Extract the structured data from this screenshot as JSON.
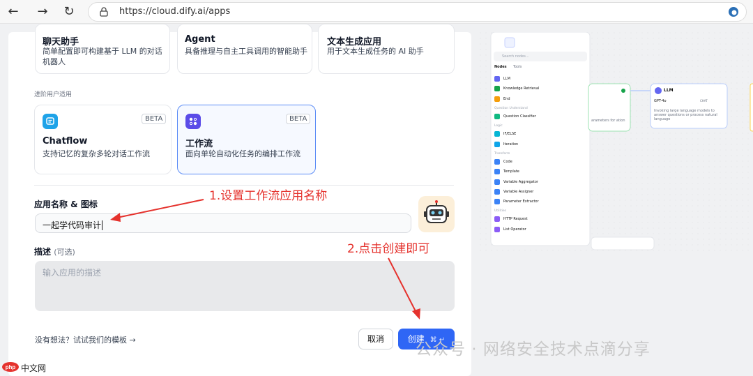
{
  "browser": {
    "url": "https://cloud.dify.ai/apps"
  },
  "app_types": {
    "basic": [
      {
        "title": "聊天助手",
        "desc": "简单配置即可构建基于 LLM 的对话机器人"
      },
      {
        "title": "Agent",
        "desc": "具备推理与自主工具调用的智能助手"
      },
      {
        "title": "文本生成应用",
        "desc": "用于文本生成任务的 AI 助手"
      }
    ],
    "advanced_label": "进阶用户适用",
    "advanced": [
      {
        "title": "Chatflow",
        "desc": "支持记忆的复杂多轮对话工作流",
        "badge": "BETA"
      },
      {
        "title": "工作流",
        "desc": "面向单轮自动化任务的编排工作流",
        "badge": "BETA"
      }
    ]
  },
  "form": {
    "name_label": "应用名称 & 图标",
    "name_value": "一起学代码审计",
    "desc_label": "描述",
    "desc_optional": "(可选)",
    "desc_placeholder": "输入应用的描述"
  },
  "footer": {
    "template_link": "没有想法？试试我们的模板",
    "template_arrow": "→",
    "cancel_label": "取消",
    "create_label": "创建",
    "create_shortcut": "⌘ ↵"
  },
  "annotations": {
    "step1": "1.设置工作流应用名称",
    "step2": "2.点击创建即可"
  },
  "preview": {
    "search_placeholder": "Search nodes...",
    "tabs": [
      "Nodes",
      "Tools"
    ],
    "groups": [
      {
        "title": "",
        "items": [
          "LLM",
          "Knowledge Retrieval",
          "End"
        ]
      },
      {
        "title": "Question Understand",
        "items": [
          "Question Classifier"
        ]
      },
      {
        "title": "Logic",
        "items": [
          "IF/ELSE",
          "Iteration"
        ]
      },
      {
        "title": "Transform",
        "items": [
          "Code",
          "Template",
          "Variable Aggregator",
          "Variable Assigner",
          "Parameter Extractor"
        ]
      },
      {
        "title": "Utilities",
        "items": [
          "HTTP Request",
          "List Operator"
        ]
      }
    ],
    "llm_node": {
      "title": "LLM",
      "model": "GPT-4o",
      "mode": "CHAT",
      "desc": "Invoking large language models to answer questions or process natural language"
    },
    "partial_text": "arameters for ation"
  },
  "watermark": "公众号 · 网络安全技术点滴分享",
  "site_logo": "php中文网",
  "colors": {
    "accent": "#2f66f5",
    "annotation": "#e5322d",
    "selected_border": "#5b8cf6"
  }
}
